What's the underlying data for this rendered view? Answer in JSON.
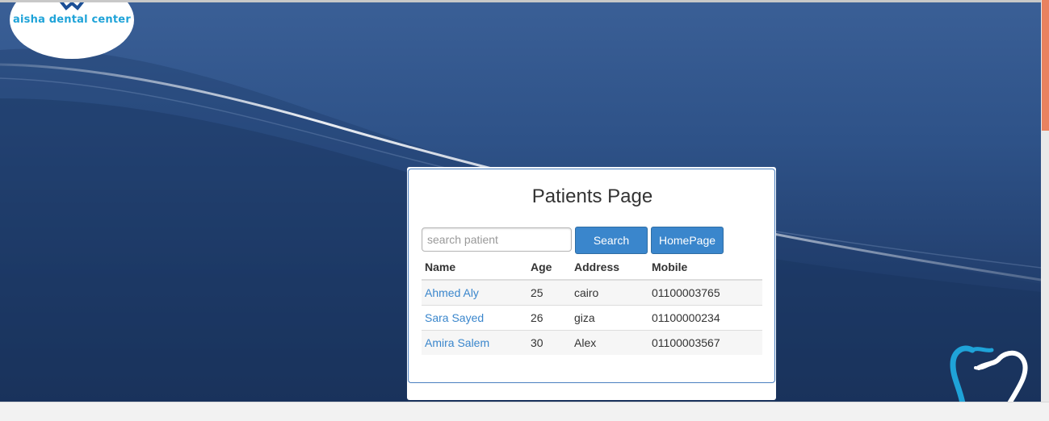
{
  "brand": {
    "logo_text": "aisha dental center"
  },
  "card": {
    "title": "Patients Page",
    "search": {
      "placeholder": "search patient",
      "value": ""
    },
    "search_button": "Search",
    "home_button": "HomePage"
  },
  "table": {
    "headers": [
      "Name",
      "Age",
      "Address",
      "Mobile"
    ],
    "rows": [
      {
        "name": "Ahmed Aly",
        "age": "25",
        "address": "cairo",
        "mobile": "01100003765"
      },
      {
        "name": "Sara Sayed",
        "age": "26",
        "address": "giza",
        "mobile": "01100000234"
      },
      {
        "name": "Amira Salem",
        "age": "30",
        "address": "Alex",
        "mobile": "01100003567"
      }
    ]
  },
  "colors": {
    "accent": "#3a86cc",
    "background_blue": "#2e5288",
    "logo_blue": "#1fa3d8",
    "scroll_thumb": "#e9825f"
  },
  "icons": {
    "logo": "tooth-logo-icon",
    "corner": "tooth-outline-icon"
  }
}
